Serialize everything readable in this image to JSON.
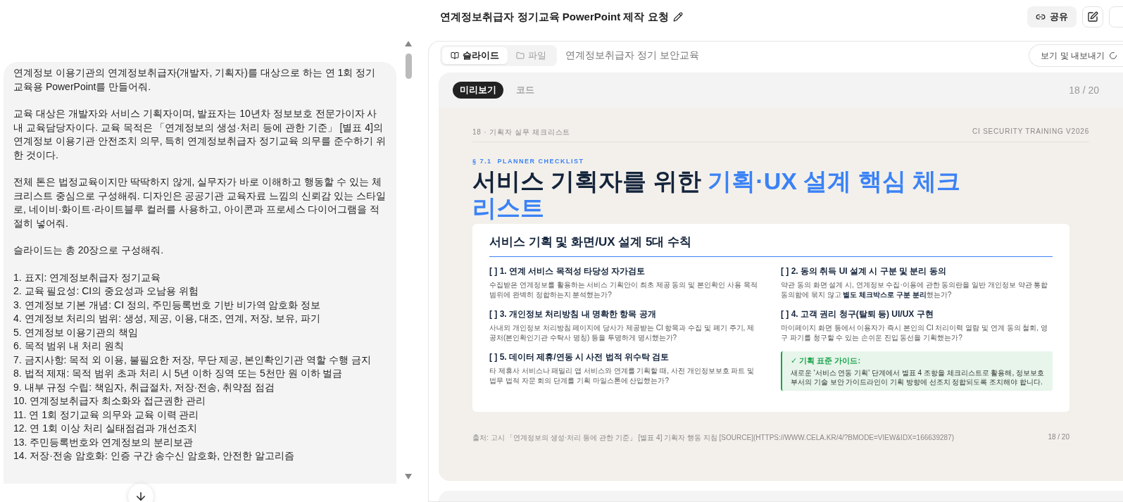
{
  "header": {
    "title": "연계정보취급자 정기교육 PowerPoint 제작 요청",
    "share_label": "공유"
  },
  "chat": {
    "paragraphs": [
      "연계정보 이용기관의 연계정보취급자(개발자, 기획자)를 대상으로 하는 연 1회 정기 교육용 PowerPoint를 만들어줘.",
      "교육 대상은 개발자와 서비스 기획자이며, 발표자는 10년차 정보보호 전문가이자 사내 교육담당자이다. 교육 목적은 「연계정보의 생성·처리 등에 관한 기준」 [별표 4]의 연계정보 이용기관 안전조치 의무, 특히 연계정보취급자 정기교육 의무를 준수하기 위한 것이다.",
      "전체 톤은 법정교육이지만 딱딱하지 않게, 실무자가 바로 이해하고 행동할 수 있는 체크리스트 중심으로 구성해줘. 디자인은 공공기관 교육자료 느낌의 신뢰감 있는 스타일로, 네이비·화이트·라이트블루 컬러를 사용하고, 아이콘과 프로세스 다이어그램을 적절히 넣어줘.",
      "슬라이드는 총 20장으로 구성해줘."
    ],
    "list": [
      "1. 표지: 연계정보취급자 정기교육",
      "2. 교육 필요성: CI의 중요성과 오남용 위험",
      "3. 연계정보 기본 개념: CI 정의, 주민등록번호 기반 비가역 암호화 정보",
      "4. 연계정보 처리의 범위: 생성, 제공, 이용, 대조, 연계, 저장, 보유, 파기",
      "5. 연계정보 이용기관의 책임",
      "6. 목적 범위 내 처리 원칙",
      "7. 금지사항: 목적 외 이용, 불필요한 저장, 무단 제공, 본인확인기관 역할 수행 금지",
      "8. 법적 제재: 목적 범위 초과 처리 시 5년 이하 징역 또는 5천만 원 이하 벌금",
      "9. 내부 규정 수립: 책임자, 취급절차, 저장·전송, 취약점 점검",
      "10. 연계정보취급자 최소화와 접근권한 관리",
      "11. 연 1회 정기교육 의무와 교육 이력 관리",
      "12. 연 1회 이상 처리 실태점검과 개선조치",
      "13. 주민등록번호와 연계정보의 분리보관",
      "14. 저장·전송 암호화: 인증 구간 송수신 암호화, 안전한 알고리즘"
    ]
  },
  "panel": {
    "tabs": [
      {
        "label": "슬라이드",
        "selected": true
      },
      {
        "label": "파일",
        "selected": false
      }
    ],
    "deck_title": "연계정보취급자 정기 보안교육",
    "export_label": "보기 및 내보내기"
  },
  "preview": {
    "tabs": [
      {
        "label": "미리보기",
        "selected": true
      },
      {
        "label": "코드",
        "selected": false
      }
    ],
    "counter": "18 / 20"
  },
  "slide": {
    "breadcrumb": "18 · 기획자 실무 체크리스트",
    "brand": "CI SECURITY TRAINING V2026",
    "kicker": "§ 7.1  PLANNER CHECKLIST",
    "title": "서비스 기획자를 위한 *기획·UX 설계 핵심 체크리스트*",
    "card_title": "서비스 기획 및 화면/UX 설계 5대 수칙",
    "items": [
      {
        "title": "[ ] 1. 연계 서비스 목적성 타당성 자가검토",
        "text": "수집받은 연계정보를 활용하는 서비스 기획안이 최초 제공 동의 및 본인확인 사용 목적 범위에 완벽히 정합하는지 분석했는가?"
      },
      {
        "title": "[ ] 2. 동의 취득 UI 설계 시 구분 및 분리 동의",
        "text": "약관 동의 화면 설계 시, 연계정보 수집·이용에 관한 동의란을 일반 개인정보 약관 통합 동의함에 묶지 않고 **별도 체크박스로 구분 분리**했는가?"
      },
      {
        "title": "[ ] 3. 개인정보 처리방침 내 명확한 항목 공개",
        "text": "사내외 개인정보 처리방침 페이지에 당사가 제공받는 CI 항목과 수집 및 폐기 주기, 제공처(본인확인기관 수탁사 명칭) 등을 투명하게 명시했는가?"
      },
      {
        "title": "[ ] 4. 고객 권리 청구(탈퇴 등) UI/UX 구현",
        "text": "마이페이지 화면 등에서 이용자가 즉시 본인의 CI 처리이력 열람 및 연계 동의 철회, 영구 파기를 청구할 수 있는 손쉬운 진입 동선을 기획했는가?"
      },
      {
        "title": "[ ] 5. 데이터 제휴/연동 시 사전 법적 위수탁 검토",
        "text": "타 제휴사 서비스나 패밀리 앱 서비스와 연계를 기획할 때, 사전 개인정보보호 파트 및 법무 법적 자문 회의 단계를 기획 마일스톤에 산입했는가?"
      }
    ],
    "guide": {
      "title": "✓ 기획 표준 가이드:",
      "text": "새로운 '서비스 연동 기획' 단계에서 별표 4 조항을 체크리스트로 활용해, 정보보호 부서의 기술 보안 가이드라인이 기획 방향에 선조치 정합되도록 조치해야 합니다."
    },
    "source": "출처: 고시 「연계정보의 생성·처리 등에 관한 기준」 [별표 4] 기획자 행동 지침 [SOURCE](HTTPS://WWW.CELA.KR/4/?BMODE=VIEW&IDX=166639287)",
    "page": "18 / 20"
  }
}
